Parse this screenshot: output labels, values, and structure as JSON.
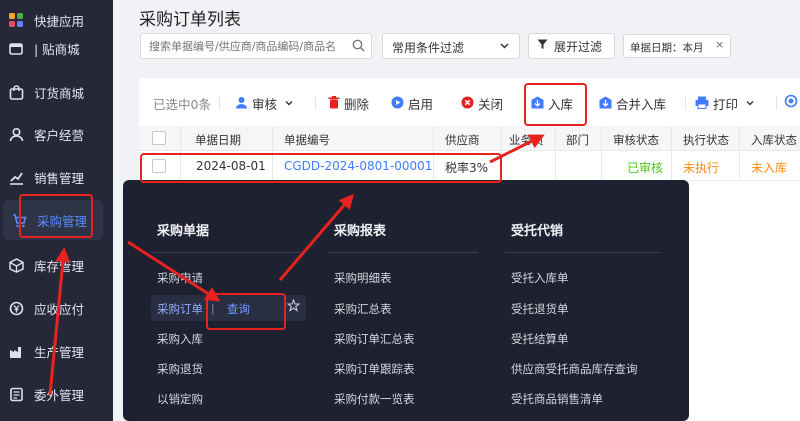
{
  "sidebar": {
    "items": [
      {
        "label": "快捷应用",
        "icon": "apps-grid-icon"
      },
      {
        "label": "| 贴商城",
        "icon": "store-icon"
      },
      {
        "label": "订货商城",
        "icon": "shopping-bag-icon"
      },
      {
        "label": "客户经营",
        "icon": "user-icon"
      },
      {
        "label": "销售管理",
        "icon": "chart-icon"
      },
      {
        "label": "采购管理",
        "icon": "cart-icon"
      },
      {
        "label": "库存管理",
        "icon": "box-icon"
      },
      {
        "label": "应收应付",
        "icon": "money-icon"
      },
      {
        "label": "生产管理",
        "icon": "factory-icon"
      },
      {
        "label": "委外管理",
        "icon": "outsource-icon"
      }
    ]
  },
  "header": {
    "title": "采购订单列表",
    "search_placeholder": "搜索单据编号/供应商/商品编码/商品名",
    "filter_select": "常用条件过滤",
    "expand_filter": "展开过滤",
    "date_tag": "单据日期：本月",
    "date_tag_close": "×"
  },
  "toolbar": {
    "selected": "已选中0条",
    "audit": "审核",
    "delete": "删除",
    "enable": "启用",
    "close": "关闭",
    "stock_in": "入库",
    "merge_stock_in": "合并入库",
    "print": "打印"
  },
  "table": {
    "columns": [
      "单据日期",
      "单据编号",
      "供应商",
      "业务员",
      "部门",
      "审核状态",
      "执行状态",
      "入库状态"
    ],
    "rows": [
      {
        "date": "2024-08-01",
        "code": "CGDD-2024-0801-00001",
        "supplier": "税率3%",
        "salesman": "",
        "dept": "",
        "audit_status": "已审核",
        "exec_status": "未执行",
        "stock_status": "未入库"
      }
    ]
  },
  "menu": {
    "col1": {
      "title": "采购单据",
      "items": [
        "采购申请",
        "采购订单",
        "采购入库",
        "采购退货",
        "以销定购"
      ],
      "query": "查询",
      "sep": "|"
    },
    "col2": {
      "title": "采购报表",
      "items": [
        "采购明细表",
        "采购汇总表",
        "采购订单汇总表",
        "采购订单跟踪表",
        "采购付款一览表"
      ]
    },
    "col3": {
      "title": "受托代销",
      "items": [
        "受托入库单",
        "受托退货单",
        "受托结算单",
        "供应商受托商品库存查询",
        "受托商品销售清单"
      ]
    }
  },
  "colors": {
    "sidebar_bg": "#252839",
    "accent": "#3f7cff",
    "annotation_red": "#e8231f",
    "audited_green": "#52c41a",
    "pending_orange": "#fa8c16"
  }
}
